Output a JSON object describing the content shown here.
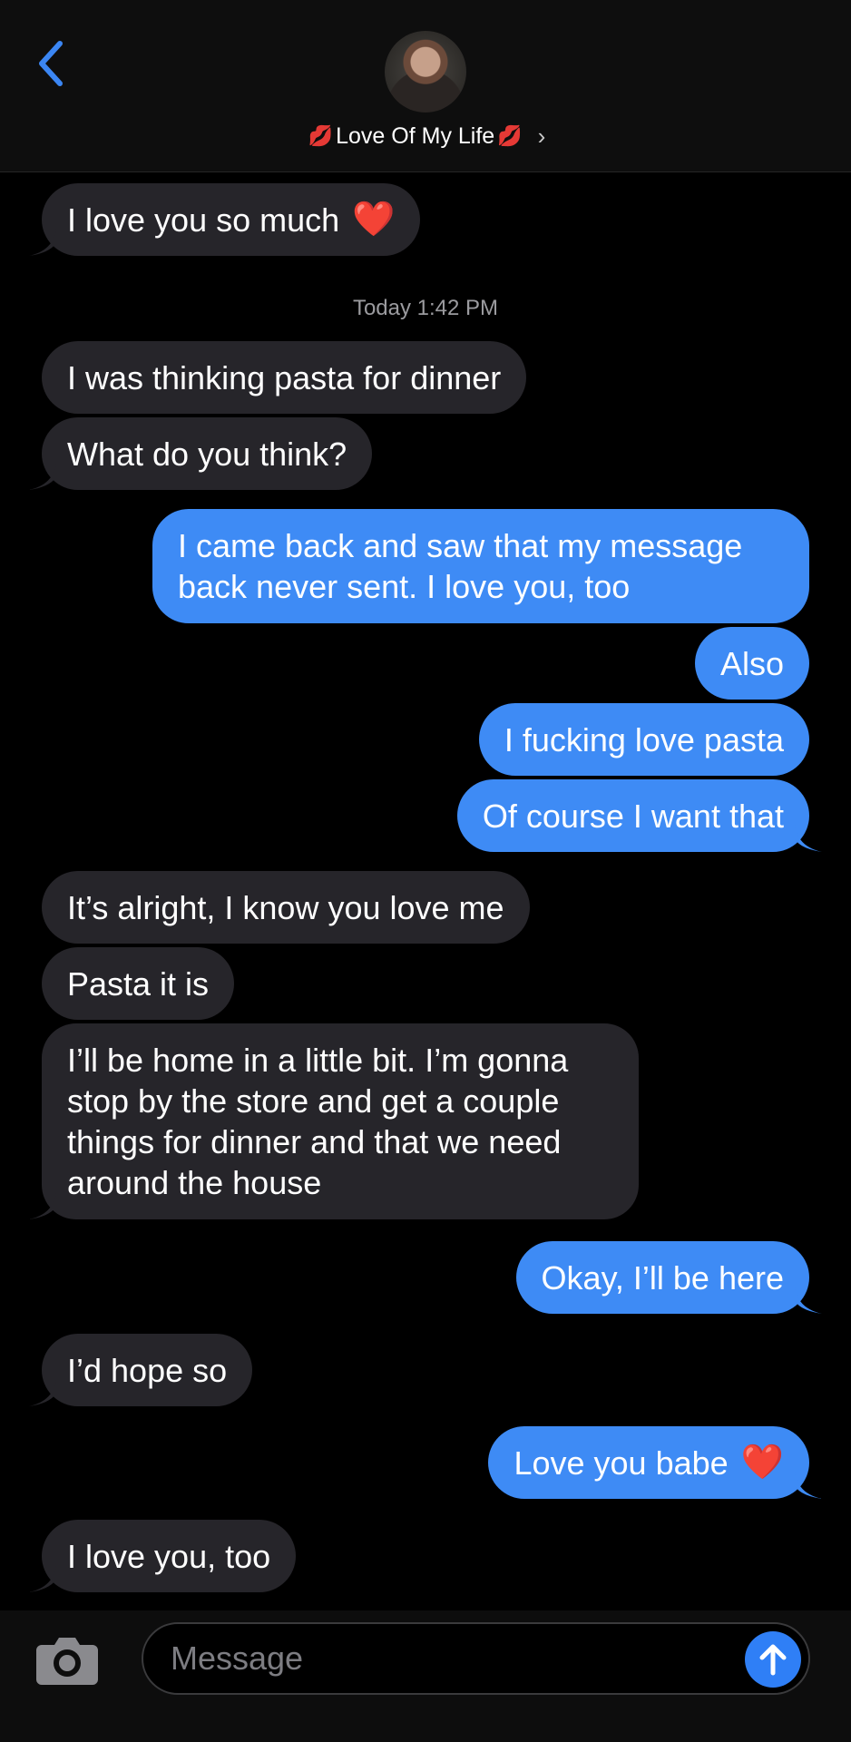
{
  "header": {
    "contact_name": "Love Of My Life",
    "name_prefix_emoji": "💋",
    "name_suffix_emoji": "💋",
    "chevron": "›"
  },
  "thread": {
    "timestamp": "Today 1:42 PM",
    "messages": [
      {
        "direction": "in",
        "text": "I love you so much",
        "emoji": "❤️"
      },
      {
        "direction": "in",
        "text": "I was thinking pasta for dinner"
      },
      {
        "direction": "in",
        "text": "What do you think?"
      },
      {
        "direction": "out",
        "lines": [
          "I came back and saw that my message",
          "back never sent. I love you, too"
        ]
      },
      {
        "direction": "out",
        "text": "Also"
      },
      {
        "direction": "out",
        "text": "I fucking love pasta"
      },
      {
        "direction": "out",
        "text": "Of course I want that"
      },
      {
        "direction": "in",
        "text": "It’s alright, I know you love me"
      },
      {
        "direction": "in",
        "text": "Pasta it is"
      },
      {
        "direction": "in",
        "lines": [
          "I’ll be home in a little bit. I’m gonna",
          "stop by the store and get a couple",
          "things for dinner and that we need",
          "around the house"
        ]
      },
      {
        "direction": "out",
        "text": "Okay, I’ll be here"
      },
      {
        "direction": "in",
        "text": "I’d hope so"
      },
      {
        "direction": "out",
        "text": "Love you babe",
        "emoji": "❤️"
      },
      {
        "direction": "in",
        "text": "I love you, too"
      }
    ]
  },
  "composer": {
    "placeholder": "Message"
  },
  "colors": {
    "incoming_bubble": "#26252a",
    "outgoing_bubble": "#3e8bf5",
    "accent": "#2f7ff6"
  },
  "icons": {
    "back": "chevron-left-icon",
    "camera": "camera-icon",
    "send": "arrow-up-icon"
  }
}
